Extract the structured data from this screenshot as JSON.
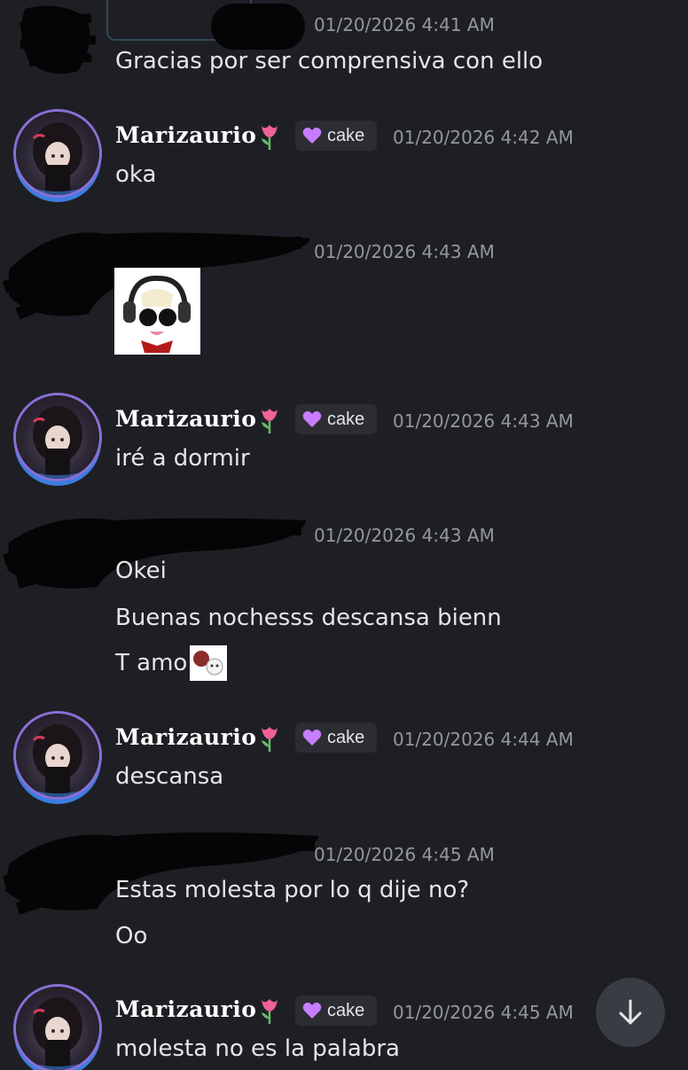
{
  "messages": [
    {
      "time": "01/20/2026 4:41 AM",
      "lines": [
        "Gracias por ser comprensiva con ello"
      ]
    },
    {
      "username": "Marizaurio",
      "tag": "cake",
      "time": "01/20/2026 4:42 AM",
      "lines": [
        "oka"
      ]
    },
    {
      "time": "01/20/2026 4:43 AM",
      "lines": []
    },
    {
      "username": "Marizaurio",
      "tag": "cake",
      "time": "01/20/2026 4:43 AM",
      "lines": [
        "iré a dormir"
      ]
    },
    {
      "time": "01/20/2026 4:43 AM",
      "lines": [
        "Okei",
        "Buenas nochesss descansa bienn",
        "T amo"
      ]
    },
    {
      "username": "Marizaurio",
      "tag": "cake",
      "time": "01/20/2026 4:44 AM",
      "lines": [
        "descansa"
      ]
    },
    {
      "time": "01/20/2026 4:45 AM",
      "lines": [
        "Estas molesta por lo q dije no?",
        "Oo"
      ]
    },
    {
      "username": "Marizaurio",
      "tag": "cake",
      "time": "01/20/2026 4:45 AM",
      "lines": [
        "molesta no es la palabra"
      ]
    }
  ],
  "icons": {
    "username_emoji": "tulip-icon",
    "tag_icon": "purple-heart-icon",
    "scroll": "arrow-down-icon"
  },
  "colors": {
    "background": "#1e1f24",
    "timestamp": "#94979f",
    "tag_bg": "#2c2d33",
    "heart": "#c77dff"
  }
}
